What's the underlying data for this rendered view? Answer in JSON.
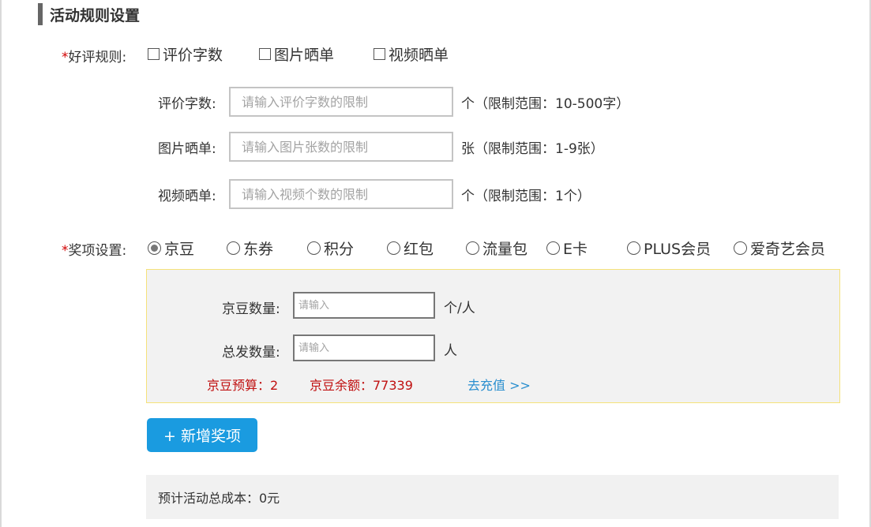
{
  "section": {
    "title": "活动规则设置"
  },
  "review_rules": {
    "required_mark": "*",
    "label": "好评规则:",
    "options": [
      {
        "label": "评价字数",
        "checked": false
      },
      {
        "label": "图片晒单",
        "checked": false
      },
      {
        "label": "视频晒单",
        "checked": false
      }
    ]
  },
  "fields": [
    {
      "label": "评价字数:",
      "placeholder": "请输入评价字数的限制",
      "value": "",
      "hint": "个（限制范围：10-500字）"
    },
    {
      "label": "图片晒单:",
      "placeholder": "请输入图片张数的限制",
      "value": "",
      "hint": "张（限制范围：1-9张）"
    },
    {
      "label": "视频晒单:",
      "placeholder": "请输入视频个数的限制",
      "value": "",
      "hint": "个（限制范围：1个）"
    }
  ],
  "prize_settings": {
    "required_mark": "*",
    "label": "奖项设置:",
    "options": [
      {
        "label": "京豆",
        "selected": true
      },
      {
        "label": "东券",
        "selected": false
      },
      {
        "label": "积分",
        "selected": false
      },
      {
        "label": "红包",
        "selected": false
      },
      {
        "label": "流量包",
        "selected": false
      },
      {
        "label": "E卡",
        "selected": false
      },
      {
        "label": "PLUS会员",
        "selected": false
      },
      {
        "label": "爱奇艺会员",
        "selected": false
      }
    ]
  },
  "prize_box": {
    "quantity": {
      "label": "京豆数量:",
      "placeholder": "请输入",
      "value": "",
      "unit": "个/人"
    },
    "total": {
      "label": "总发数量:",
      "placeholder": "请输入",
      "value": "",
      "unit": "人"
    },
    "budget": "京豆预算：2",
    "balance": "京豆余额：77339",
    "recharge_link": "去充值 >>"
  },
  "add_prize_button": "+ 新增奖项",
  "total_cost": "预计活动总成本：0元",
  "colors": {
    "accent_button": "#1a9be0",
    "link": "#2a8fcf",
    "warning_text": "#c01010",
    "prize_box_border": "#f5e27a"
  }
}
